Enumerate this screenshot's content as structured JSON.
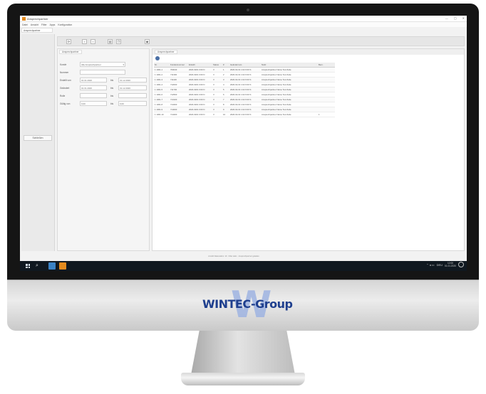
{
  "window": {
    "title": "Ansprechpartner",
    "controls": [
      "—",
      "▢",
      "✕"
    ]
  },
  "menu": [
    "Datei",
    "Ansicht",
    "Filter",
    "Apps",
    "Konfiguration"
  ],
  "document_tab": "Ansprechpartner",
  "left_strip_button": "Schließen",
  "toolbar_icons": [
    "refresh-icon",
    "back-icon",
    "forward-icon",
    "print-icon",
    "copy-icon",
    "view-icon"
  ],
  "form": {
    "tab": "Ansprechpartner",
    "rows": [
      {
        "label": "Kunde",
        "value": "Alle Ansprechpartner",
        "suffix": "▾"
      },
      {
        "label": "Nummer",
        "value": ""
      },
      {
        "label": "Erstellt von",
        "value": "01.01.2020",
        "label2": "bis",
        "value2": "31.12.2020"
      },
      {
        "label": "Geändert",
        "value": "01.01.2020",
        "label2": "bis",
        "value2": "31.12.2020"
      },
      {
        "label": "Rolle",
        "value": "",
        "label2": "bis",
        "value2": ""
      },
      {
        "label": "Gültig von",
        "value": "0,00",
        "label2": "bis",
        "value2": "0,00"
      }
    ]
  },
  "grid": {
    "tab": "Ansprechpartner",
    "columns": [
      "Nr.",
      "Kundennummer",
      "Erstellt",
      "Status",
      "#",
      "Geändert am",
      "Notiz",
      "Bem."
    ],
    "rows": [
      [
        "1 1001-1",
        "700040",
        "2020-0201 0:00 N",
        "V",
        "1",
        "2020-02-01 1:02 0:00 S",
        "Ansprechpartner Name Text Zeile",
        ""
      ],
      [
        "1 1001-2",
        "711300",
        "2020-0201 0:00 N",
        "V",
        "2",
        "2020-02-01 1:02 0:00 S",
        "Ansprechpartner Name Text Zeile",
        ""
      ],
      [
        "1 1001-3",
        "711100",
        "2020-0201 0:00 N",
        "V",
        "3",
        "2020-02-01 1:02 0:00 S",
        "Ansprechpartner Name Text Zeile",
        ""
      ],
      [
        "1 1001-4",
        "712000",
        "2020-0201 0:00 N",
        "V",
        "4",
        "2020-02-01 1:02 0:00 S",
        "Ansprechpartner Name Text Zeile",
        ""
      ],
      [
        "1 1001-5",
        "711700",
        "2020-0201 0:00 N",
        "V",
        "5",
        "2020-02-01 1:02 0:00 S",
        "Ansprechpartner Name Text Zeile",
        ""
      ],
      [
        "1 1001-6",
        "712500",
        "2020-0201 0:00 N",
        "V",
        "6",
        "2020-02-01 1:02 0:00 S",
        "Ansprechpartner Name Text Zeile",
        ""
      ],
      [
        "1 1001-7",
        "713100",
        "2020-0201 0:00 N",
        "V",
        "7",
        "2020-02-01 1:02 0:00 S",
        "Ansprechpartner Name Text Zeile",
        ""
      ],
      [
        "1 1001-8",
        "713400",
        "2020-0201 0:00 N",
        "V",
        "8",
        "2020-02-01 1:02 0:00 S",
        "Ansprechpartner Name Text Zeile",
        ""
      ],
      [
        "1 1001-9",
        "714000",
        "2020-0201 0:00 N",
        "V",
        "9",
        "2020-02-01 1:02 0:00 S",
        "Ansprechpartner Name Text Zeile",
        ""
      ],
      [
        "1 1001-10",
        "714200",
        "2020-0201 0:00 N",
        "V",
        "10",
        "2020-02-01 1:02 0:00 S",
        "Ansprechpartner Name Text Zeile",
        "1"
      ]
    ]
  },
  "status_line": "Anzahl Datensätze: 10 · Filter aktiv · Ansprechpartner geladen",
  "taskbar": {
    "time": "12:00",
    "date": "01.01.2020",
    "lang": "DEU",
    "apps": [
      {
        "name": "explorer-app",
        "color": "#3b82c4"
      },
      {
        "name": "wintec-app",
        "color": "#e38a1e"
      }
    ]
  },
  "brand": {
    "logo_text": "WINTEC-Group",
    "logo_letter": "W",
    "color": "#1f3f8e",
    "accent": "#9fb4e2"
  }
}
